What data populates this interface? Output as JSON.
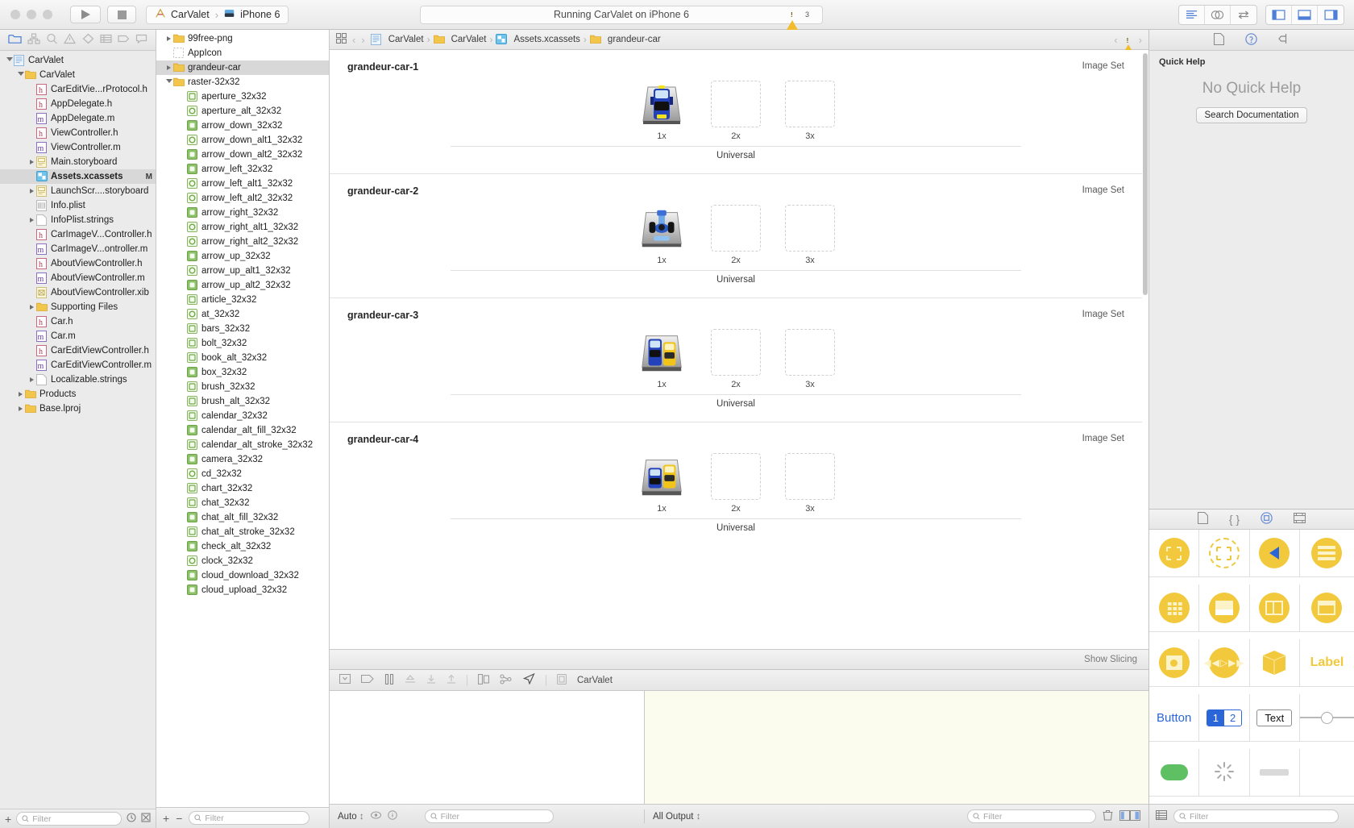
{
  "titlebar": {
    "run_button": "run-button",
    "stop_button": "stop-button",
    "scheme_project": "CarValet",
    "scheme_device": "iPhone 6",
    "status_text": "Running CarValet on iPhone 6",
    "warning_count": "3"
  },
  "navigator": {
    "tabs": [
      "folder-icon",
      "hierarchy-icon",
      "search-icon",
      "warning-icon",
      "breakpoint-icon",
      "report-icon",
      "tag-icon",
      "log-icon"
    ],
    "filter_placeholder": "Filter",
    "items": [
      {
        "label": "CarValet",
        "depth": 0,
        "icon": "project",
        "twisty": "down"
      },
      {
        "label": "CarValet",
        "depth": 1,
        "icon": "folder",
        "twisty": "down"
      },
      {
        "label": "CarEditVie...rProtocol.h",
        "depth": 2,
        "icon": "h"
      },
      {
        "label": "AppDelegate.h",
        "depth": 2,
        "icon": "h"
      },
      {
        "label": "AppDelegate.m",
        "depth": 2,
        "icon": "m"
      },
      {
        "label": "ViewController.h",
        "depth": 2,
        "icon": "h"
      },
      {
        "label": "ViewController.m",
        "depth": 2,
        "icon": "m"
      },
      {
        "label": "Main.storyboard",
        "depth": 2,
        "icon": "storyboard",
        "twisty": "right"
      },
      {
        "label": "Assets.xcassets",
        "depth": 2,
        "icon": "assets",
        "selected": true,
        "flag": "M"
      },
      {
        "label": "LaunchScr....storyboard",
        "depth": 2,
        "icon": "storyboard",
        "twisty": "right"
      },
      {
        "label": "Info.plist",
        "depth": 2,
        "icon": "plist"
      },
      {
        "label": "InfoPlist.strings",
        "depth": 2,
        "icon": "file",
        "twisty": "right"
      },
      {
        "label": "CarImageV...Controller.h",
        "depth": 2,
        "icon": "h"
      },
      {
        "label": "CarImageV...ontroller.m",
        "depth": 2,
        "icon": "m"
      },
      {
        "label": "AboutViewController.h",
        "depth": 2,
        "icon": "h"
      },
      {
        "label": "AboutViewController.m",
        "depth": 2,
        "icon": "m"
      },
      {
        "label": "AboutViewController.xib",
        "depth": 2,
        "icon": "xib"
      },
      {
        "label": "Supporting Files",
        "depth": 2,
        "icon": "folder",
        "twisty": "right"
      },
      {
        "label": "Car.h",
        "depth": 2,
        "icon": "h"
      },
      {
        "label": "Car.m",
        "depth": 2,
        "icon": "m"
      },
      {
        "label": "CarEditViewController.h",
        "depth": 2,
        "icon": "h"
      },
      {
        "label": "CarEditViewController.m",
        "depth": 2,
        "icon": "m"
      },
      {
        "label": "Localizable.strings",
        "depth": 2,
        "icon": "file",
        "twisty": "right"
      },
      {
        "label": "Products",
        "depth": 1,
        "icon": "folder",
        "twisty": "right"
      },
      {
        "label": "Base.lproj",
        "depth": 1,
        "icon": "folder",
        "twisty": "right"
      }
    ]
  },
  "asset_catalog": {
    "filter_placeholder": "Filter",
    "items": [
      {
        "label": "99free-png",
        "icon": "folder",
        "twisty": "right"
      },
      {
        "label": "AppIcon",
        "icon": "appicon"
      },
      {
        "label": "grandeur-car",
        "icon": "folder",
        "twisty": "right",
        "selected": true
      },
      {
        "label": "raster-32x32",
        "icon": "folder",
        "twisty": "down"
      },
      {
        "label": "aperture_32x32",
        "icon": "green",
        "indent": true
      },
      {
        "label": "aperture_alt_32x32",
        "icon": "green-circ",
        "indent": true
      },
      {
        "label": "arrow_down_32x32",
        "icon": "green-solid",
        "indent": true
      },
      {
        "label": "arrow_down_alt1_32x32",
        "icon": "green-circ",
        "indent": true
      },
      {
        "label": "arrow_down_alt2_32x32",
        "icon": "green-solid",
        "indent": true
      },
      {
        "label": "arrow_left_32x32",
        "icon": "green-solid",
        "indent": true
      },
      {
        "label": "arrow_left_alt1_32x32",
        "icon": "green-circ",
        "indent": true
      },
      {
        "label": "arrow_left_alt2_32x32",
        "icon": "green-circ",
        "indent": true
      },
      {
        "label": "arrow_right_32x32",
        "icon": "green-solid",
        "indent": true
      },
      {
        "label": "arrow_right_alt1_32x32",
        "icon": "green-circ",
        "indent": true
      },
      {
        "label": "arrow_right_alt2_32x32",
        "icon": "green-circ",
        "indent": true
      },
      {
        "label": "arrow_up_32x32",
        "icon": "green-solid",
        "indent": true
      },
      {
        "label": "arrow_up_alt1_32x32",
        "icon": "green-circ",
        "indent": true
      },
      {
        "label": "arrow_up_alt2_32x32",
        "icon": "green-solid",
        "indent": true
      },
      {
        "label": "article_32x32",
        "icon": "green",
        "indent": true
      },
      {
        "label": "at_32x32",
        "icon": "green-circ",
        "indent": true
      },
      {
        "label": "bars_32x32",
        "icon": "green",
        "indent": true
      },
      {
        "label": "bolt_32x32",
        "icon": "green",
        "indent": true
      },
      {
        "label": "book_alt_32x32",
        "icon": "green",
        "indent": true
      },
      {
        "label": "box_32x32",
        "icon": "green-solid",
        "indent": true
      },
      {
        "label": "brush_32x32",
        "icon": "green",
        "indent": true
      },
      {
        "label": "brush_alt_32x32",
        "icon": "green",
        "indent": true
      },
      {
        "label": "calendar_32x32",
        "icon": "green",
        "indent": true
      },
      {
        "label": "calendar_alt_fill_32x32",
        "icon": "green-solid",
        "indent": true
      },
      {
        "label": "calendar_alt_stroke_32x32",
        "icon": "green",
        "indent": true
      },
      {
        "label": "camera_32x32",
        "icon": "green-solid",
        "indent": true
      },
      {
        "label": "cd_32x32",
        "icon": "green-circ",
        "indent": true
      },
      {
        "label": "chart_32x32",
        "icon": "green",
        "indent": true
      },
      {
        "label": "chat_32x32",
        "icon": "green",
        "indent": true
      },
      {
        "label": "chat_alt_fill_32x32",
        "icon": "green-solid",
        "indent": true
      },
      {
        "label": "chat_alt_stroke_32x32",
        "icon": "green",
        "indent": true
      },
      {
        "label": "check_alt_32x32",
        "icon": "green-solid",
        "indent": true
      },
      {
        "label": "clock_32x32",
        "icon": "green-circ",
        "indent": true
      },
      {
        "label": "cloud_download_32x32",
        "icon": "green-solid",
        "indent": true
      },
      {
        "label": "cloud_upload_32x32",
        "icon": "green-solid",
        "indent": true
      }
    ]
  },
  "editor": {
    "breadcrumbs": [
      {
        "label": "CarValet",
        "icon": "project"
      },
      {
        "label": "CarValet",
        "icon": "folder"
      },
      {
        "label": "Assets.xcassets",
        "icon": "assets"
      },
      {
        "label": "grandeur-car",
        "icon": "folder"
      }
    ],
    "slicing_button": "Show Slicing",
    "image_sets": [
      {
        "name": "grandeur-car-1",
        "kind": "Image Set",
        "device": "Universal",
        "slots": [
          {
            "scale": "1x",
            "filled": true,
            "art": "blue-car-top"
          },
          {
            "scale": "2x",
            "filled": false
          },
          {
            "scale": "3x",
            "filled": false
          }
        ]
      },
      {
        "name": "grandeur-car-2",
        "kind": "Image Set",
        "device": "Universal",
        "slots": [
          {
            "scale": "1x",
            "filled": true,
            "art": "blue-racecar"
          },
          {
            "scale": "2x",
            "filled": false
          },
          {
            "scale": "3x",
            "filled": false
          }
        ]
      },
      {
        "name": "grandeur-car-3",
        "kind": "Image Set",
        "device": "Universal",
        "slots": [
          {
            "scale": "1x",
            "filled": true,
            "art": "blue-yellow-cars"
          },
          {
            "scale": "2x",
            "filled": false
          },
          {
            "scale": "3x",
            "filled": false
          }
        ]
      },
      {
        "name": "grandeur-car-4",
        "kind": "Image Set",
        "device": "Universal",
        "slots": [
          {
            "scale": "1x",
            "filled": true,
            "art": "blue-yellow-cars-2"
          },
          {
            "scale": "2x",
            "filled": false
          },
          {
            "scale": "3x",
            "filled": false
          }
        ]
      }
    ]
  },
  "debug": {
    "process_name": "CarValet",
    "scope_label": "Auto",
    "variables_filter_placeholder": "Filter",
    "output_label": "All Output",
    "console_filter_placeholder": "Filter"
  },
  "utility": {
    "quick_help": {
      "title": "Quick Help",
      "empty_text": "No Quick Help",
      "search_button": "Search Documentation"
    },
    "library_tabs": [
      "file-template-icon",
      "code-snippet-icon",
      "object-library-icon",
      "media-library-icon"
    ],
    "library_items": [
      {
        "name": "view",
        "kind": "disc-square-dashed"
      },
      {
        "name": "view-controller",
        "kind": "hollow-circle-square"
      },
      {
        "name": "navigation-controller",
        "kind": "disc-blue-chevron"
      },
      {
        "name": "table-view",
        "kind": "disc-bars"
      },
      {
        "name": "collection-view",
        "kind": "disc-grid"
      },
      {
        "name": "image-cell",
        "kind": "disc-image"
      },
      {
        "name": "split-view",
        "kind": "disc-split"
      },
      {
        "name": "container-view",
        "kind": "disc-box"
      },
      {
        "name": "image-view",
        "kind": "disc-circle-square"
      },
      {
        "name": "player-view",
        "kind": "disc-player"
      },
      {
        "name": "scene-kit-view",
        "kind": "cube"
      },
      {
        "name": "label",
        "kind": "label"
      },
      {
        "name": "button",
        "kind": "button"
      },
      {
        "name": "segmented-control",
        "kind": "segmented"
      },
      {
        "name": "text-field",
        "kind": "textfield"
      },
      {
        "name": "slider",
        "kind": "slider"
      }
    ],
    "library_labels": {
      "label": "Label",
      "button": "Button",
      "segment_one": "1",
      "segment_two": "2",
      "text": "Text"
    },
    "filter_placeholder": "Filter"
  }
}
